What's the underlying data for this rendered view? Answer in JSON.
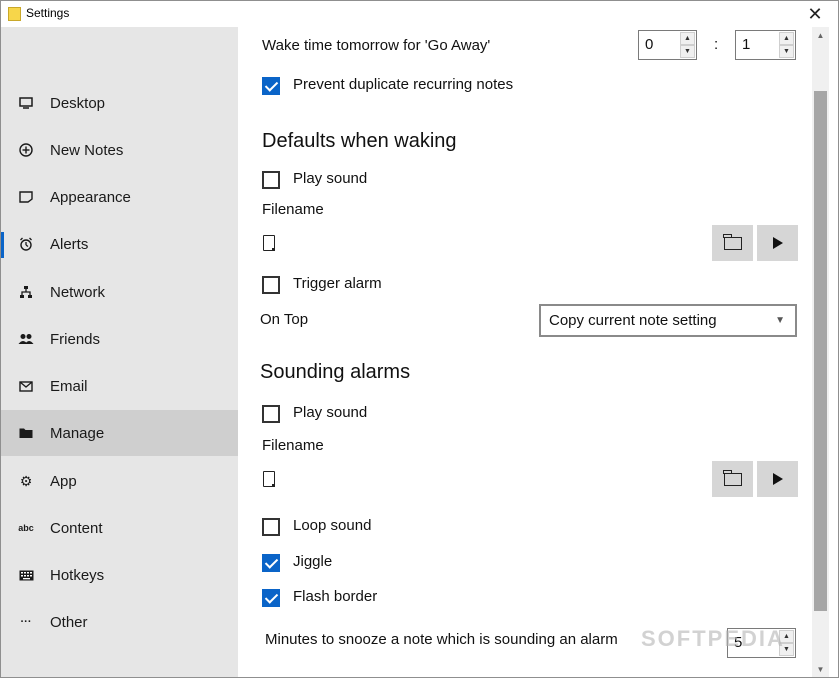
{
  "window": {
    "title": "Settings",
    "close_glyph": "✕"
  },
  "sidebar": {
    "items": [
      {
        "label": "Desktop",
        "icon": "monitor-icon",
        "glyph": "▭"
      },
      {
        "label": "New Notes",
        "icon": "plus-circle-icon",
        "glyph": "⊕"
      },
      {
        "label": "Appearance",
        "icon": "card-icon",
        "glyph": "▱"
      },
      {
        "label": "Alerts",
        "icon": "alarm-clock-icon",
        "glyph": "⏰"
      },
      {
        "label": "Network",
        "icon": "network-icon",
        "glyph": "⧉"
      },
      {
        "label": "Friends",
        "icon": "people-icon",
        "glyph": "👥"
      },
      {
        "label": "Email",
        "icon": "mail-icon",
        "glyph": "✉"
      },
      {
        "label": "Manage",
        "icon": "folder-icon",
        "glyph": "■"
      },
      {
        "label": "App",
        "icon": "gear-icon",
        "glyph": "⚙"
      },
      {
        "label": "Content",
        "icon": "abc-icon",
        "glyph": "abc"
      },
      {
        "label": "Hotkeys",
        "icon": "keyboard-icon",
        "glyph": "⌨"
      },
      {
        "label": "Other",
        "icon": "more-icon",
        "glyph": "···"
      }
    ],
    "selected": "Manage",
    "active_indicator": "Alerts"
  },
  "content": {
    "wake_label": "Wake time tomorrow for 'Go Away'",
    "wake_hours": "0",
    "wake_separator": ":",
    "wake_minutes": "1",
    "prevent_duplicates": {
      "label": "Prevent duplicate recurring notes",
      "checked": true
    },
    "defaults_heading": "Defaults when waking",
    "defaults_play_sound": {
      "label": "Play sound",
      "checked": false
    },
    "defaults_filename_label": "Filename",
    "defaults_trigger_alarm": {
      "label": "Trigger alarm",
      "checked": false
    },
    "on_top_label": "On Top",
    "on_top_value": "Copy current note setting",
    "sounding_heading": "Sounding alarms",
    "sounding_play_sound": {
      "label": "Play sound",
      "checked": false
    },
    "sounding_filename_label": "Filename",
    "loop_sound": {
      "label": "Loop sound",
      "checked": false
    },
    "jiggle": {
      "label": "Jiggle",
      "checked": true
    },
    "flash_border": {
      "label": "Flash border",
      "checked": true
    },
    "snooze_label": "Minutes to snooze a note which is sounding an alarm",
    "snooze_value": "5"
  },
  "watermark": "SOFTPEDIA",
  "colors": {
    "accent": "#0a64c8",
    "sidebar_bg": "#e6e6e6",
    "selected_bg": "#cfcfcf"
  }
}
